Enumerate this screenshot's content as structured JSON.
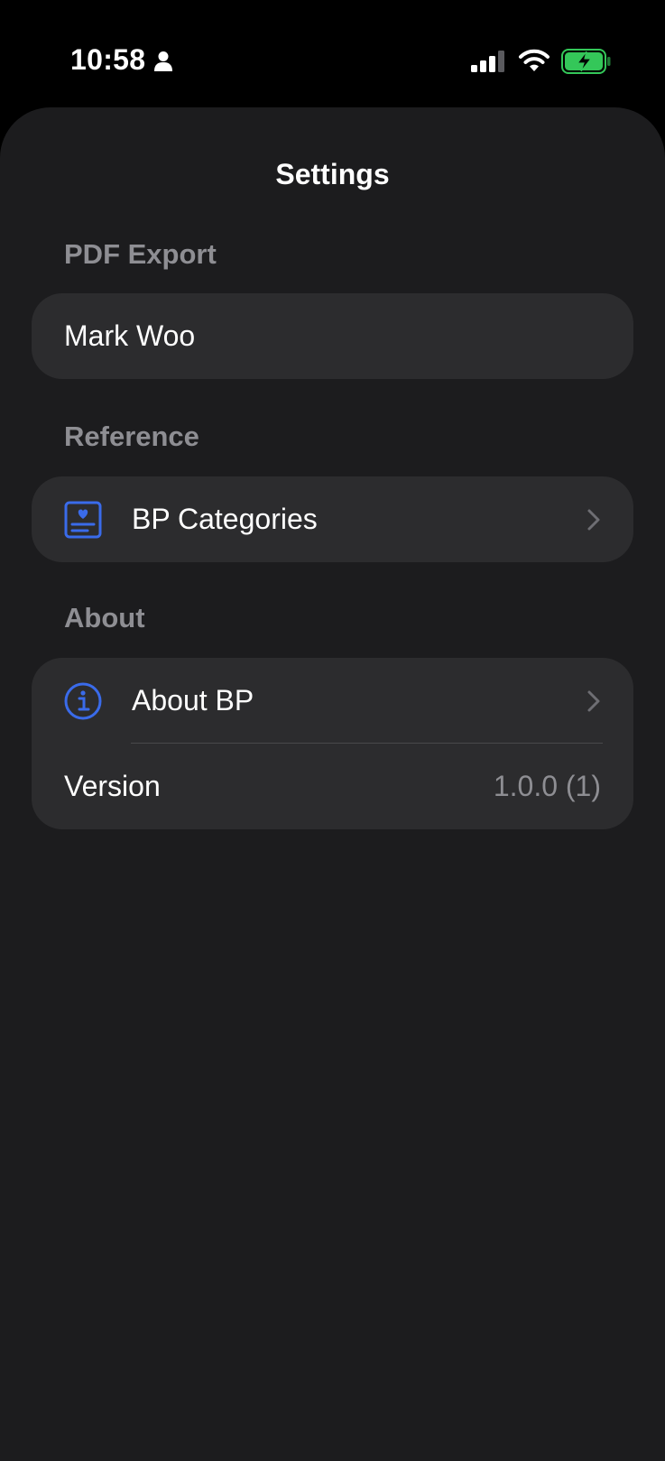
{
  "status_bar": {
    "time": "10:58",
    "icons": [
      "person-icon",
      "cellular-signal-icon",
      "wifi-icon",
      "battery-charging-icon"
    ],
    "battery_color": "#34c759"
  },
  "nav": {
    "title": "Settings"
  },
  "sections": {
    "pdf_export": {
      "header": "PDF Export",
      "name_value": "Mark Woo"
    },
    "reference": {
      "header": "Reference",
      "items": [
        {
          "label": "BP Categories",
          "icon": "bp-categories-icon"
        }
      ]
    },
    "about": {
      "header": "About",
      "items": [
        {
          "label": "About BP",
          "icon": "info-icon"
        }
      ],
      "version_label": "Version",
      "version_value": "1.0.0 (1)"
    }
  },
  "colors": {
    "accent": "#3a6bea",
    "background": "#1c1c1e",
    "cell": "#2c2c2e",
    "secondary_text": "#8e8e93"
  }
}
